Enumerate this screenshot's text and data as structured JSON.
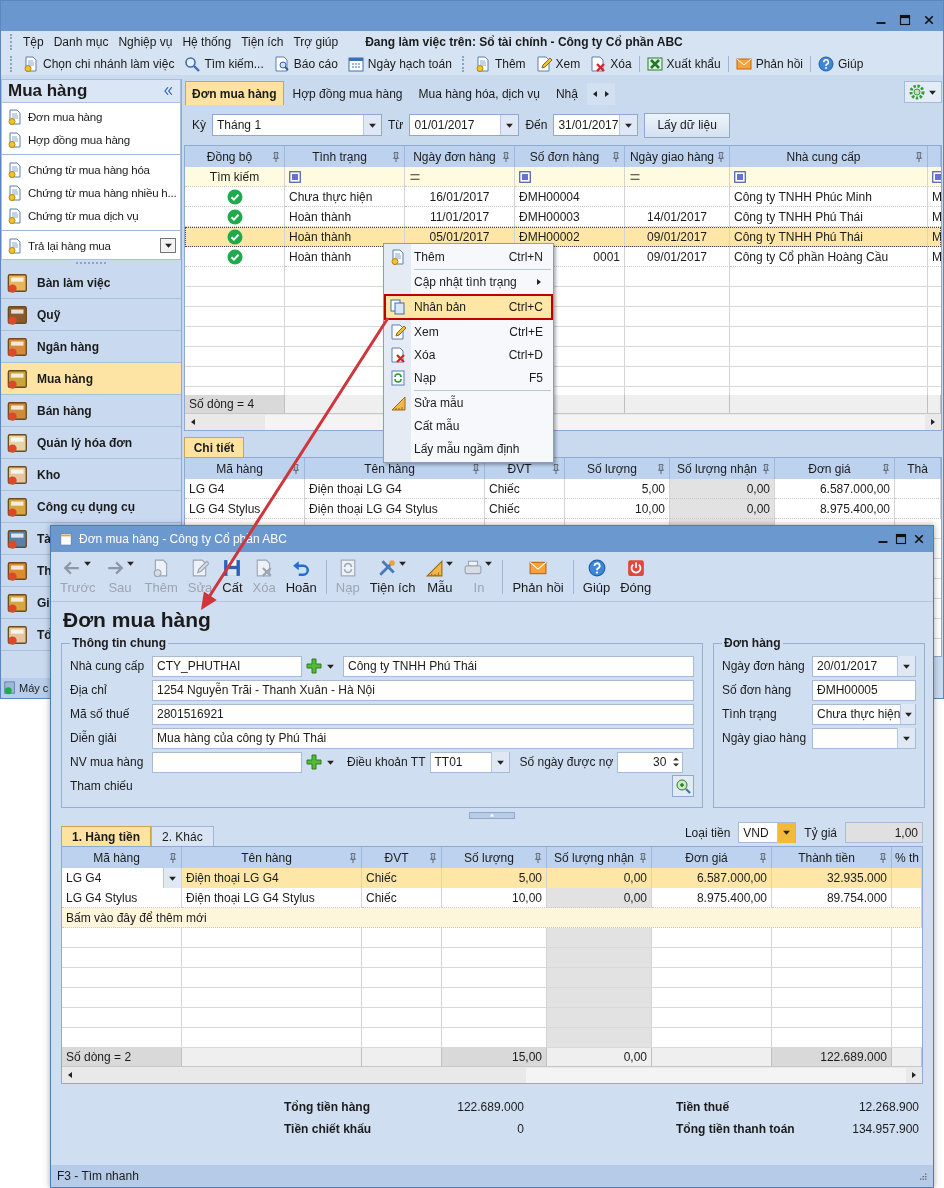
{
  "menu_bar": {
    "items": [
      "Tệp",
      "Danh mục",
      "Nghiệp vụ",
      "Hệ thống",
      "Tiện ích",
      "Trợ giúp"
    ],
    "context": "Đang làm việc trên: Sổ tài chính - Công ty Cổ phần ABC"
  },
  "toolbar": [
    [
      "Chọn chi nhánh làm việc",
      "Tìm kiếm...",
      "Báo cáo",
      "Ngày hạch toán"
    ],
    [
      "Thêm",
      "Xem",
      "Xóa"
    ],
    [
      "Xuất khẩu"
    ],
    [
      "Phản hồi"
    ],
    [
      "Giúp"
    ]
  ],
  "sidebar": {
    "title": "Mua hàng",
    "link_groups": [
      [
        "Đơn mua hàng",
        "Hợp đồng mua hàng"
      ],
      [
        "Chứng từ mua hàng hóa",
        "Chứng từ mua hàng nhiều h...",
        "Chứng từ mua dịch vụ"
      ]
    ],
    "dropdown_link": "Trả lại hàng mua",
    "modules": [
      {
        "label": "Bàn làm việc",
        "selected": false
      },
      {
        "label": "Quỹ",
        "selected": false
      },
      {
        "label": "Ngân hàng",
        "selected": false
      },
      {
        "label": "Mua hàng",
        "selected": true
      },
      {
        "label": "Bán hàng",
        "selected": false
      },
      {
        "label": "Quản lý hóa đơn",
        "selected": false
      },
      {
        "label": "Kho",
        "selected": false
      },
      {
        "label": "Công cụ dụng cụ",
        "selected": false
      },
      {
        "label": "Tà",
        "selected": false
      },
      {
        "label": "Th",
        "selected": false
      },
      {
        "label": "Gi",
        "selected": false
      },
      {
        "label": "Tổ",
        "selected": false
      }
    ],
    "status": "Máy c"
  },
  "tabs": [
    {
      "label": "Đơn mua hàng",
      "selected": true
    },
    {
      "label": "Hợp đồng mua hàng",
      "selected": false
    },
    {
      "label": "Mua hàng hóa, dịch vụ",
      "selected": false
    },
    {
      "label": "Nhậ",
      "selected": false
    }
  ],
  "filter": {
    "period_label": "Kỳ",
    "period": "Tháng 1",
    "from_label": "Từ",
    "from": "01/01/2017",
    "to_label": "Đến",
    "to": "31/01/2017",
    "button": "Lấy dữ liệu"
  },
  "orders": {
    "columns": [
      "Đồng bộ",
      "Tình trạng",
      "Ngày đơn hàng",
      "Số đơn hàng",
      "Ngày giao hàng",
      "Nhà cung cấp"
    ],
    "search_label": "Tìm kiếm",
    "rows": [
      {
        "synced": true,
        "status": "Chưa thực hiện",
        "order_date": "16/01/2017",
        "number": "ĐMH00004",
        "supplier": "Công ty TNHH Phúc Minh",
        "column_7": "M",
        "selected": false
      },
      {
        "synced": true,
        "status": "Hoàn thành",
        "order_date": "11/01/2017",
        "number": "ĐMH00003",
        "delivery_date": "14/01/2017",
        "supplier": "Công ty TNHH Phú Thái",
        "column_7": "M",
        "selected": false
      },
      {
        "synced": true,
        "status": "Hoàn thành",
        "order_date": "05/01/2017",
        "number": "ĐMH00002",
        "delivery_date": "09/01/2017",
        "supplier": "Công ty TNHH Phú Thái",
        "column_7": "M",
        "selected": true
      },
      {
        "synced": true,
        "status": "Hoàn thành",
        "number": "0001",
        "delivery_date": "09/01/2017",
        "supplier": "Công ty Cổ phần Hoàng Cầu",
        "column_7": "M",
        "selected": false
      }
    ],
    "footer": "Số dòng = 4"
  },
  "detail": {
    "tab": "Chi tiết",
    "columns": [
      "Mã hàng",
      "Tên hàng",
      "ĐVT",
      "Số lượng",
      "Số lượng nhận",
      "Đơn giá",
      "Thà"
    ],
    "rows": [
      {
        "code": "LG G4",
        "name": "Điện thoại LG G4",
        "unit": "Chiếc",
        "quantity": "5,00",
        "received": "0,00",
        "price": "6.587.000,00"
      },
      {
        "code": "LG G4 Stylus",
        "name": "Điện thoại LG G4 Stylus",
        "unit": "Chiếc",
        "quantity": "10,00",
        "received": "0,00",
        "price": "8.975.400,00"
      }
    ]
  },
  "context_menu": {
    "groups": [
      [
        {
          "label": "Thêm",
          "shortcut": "Ctrl+N",
          "kind": "item",
          "selected": false
        }
      ],
      [
        {
          "label": "Cập nhật tình trạng",
          "kind": "submenu",
          "selected": false
        }
      ],
      [
        {
          "label": "Nhân bản",
          "shortcut": "Ctrl+C",
          "kind": "item",
          "selected": true
        }
      ],
      [
        {
          "label": "Xem",
          "shortcut": "Ctrl+E",
          "kind": "item",
          "selected": false
        },
        {
          "label": "Xóa",
          "shortcut": "Ctrl+D",
          "kind": "item",
          "selected": false
        },
        {
          "label": "Nạp",
          "shortcut": "F5",
          "kind": "item",
          "selected": false
        }
      ],
      [
        {
          "label": "Sửa mẫu",
          "kind": "item",
          "selected": false
        },
        {
          "label": "Cất mẫu",
          "kind": "item",
          "selected": false
        },
        {
          "label": "Lấy mẫu ngầm định",
          "kind": "item",
          "selected": false
        }
      ]
    ]
  },
  "dialog": {
    "title": "Đơn mua hàng - Công ty Cổ phần ABC",
    "toolbar": [
      [
        {
          "label": "Trước",
          "disabled": true,
          "dropdown": true
        },
        {
          "label": "Sau",
          "disabled": true,
          "dropdown": true
        },
        {
          "label": "Thêm",
          "disabled": true,
          "dropdown": false
        },
        {
          "label": "Sửa",
          "disabled": true,
          "dropdown": false
        },
        {
          "label": "Cất",
          "disabled": false,
          "dropdown": false
        },
        {
          "label": "Xóa",
          "disabled": true,
          "dropdown": false
        },
        {
          "label": "Hoãn",
          "disabled": false,
          "dropdown": false
        }
      ],
      [
        {
          "label": "Nạp",
          "disabled": true,
          "dropdown": false
        },
        {
          "label": "Tiện ích",
          "disabled": false,
          "dropdown": true
        },
        {
          "label": "Mẫu",
          "disabled": false,
          "dropdown": true
        },
        {
          "label": "In",
          "disabled": true,
          "dropdown": true
        }
      ],
      [
        {
          "label": "Phản hồi",
          "disabled": false,
          "dropdown": false
        }
      ],
      [
        {
          "label": "Giúp",
          "disabled": false,
          "dropdown": false
        },
        {
          "label": "Đóng",
          "disabled": false,
          "dropdown": false
        }
      ]
    ],
    "heading": "Đơn mua hàng",
    "general": {
      "title": "Thông tin chung",
      "supplier_label": "Nhà cung cấp",
      "supplier_code": "CTY_PHUTHAI",
      "supplier_name": "Công ty TNHH Phú Thái",
      "address_label": "Địa chỉ",
      "address": "1254 Nguyễn Trãi - Thanh Xuân - Hà Nội",
      "tax_label": "Mã số thuế",
      "tax_code": "2801516921",
      "description_label": "Diễn giải",
      "description": "Mua hàng của công ty Phú Thái",
      "staff_label": "NV mua hàng",
      "terms_label": "Điều khoản TT",
      "terms": "TT01",
      "credit_days_label": "Số ngày được nợ",
      "credit_days": "30",
      "reference_label": "Tham chiếu"
    },
    "order": {
      "title": "Đơn hàng",
      "fields": [
        {
          "label": "Ngày đơn hàng",
          "value": "20/01/2017",
          "kind": "dropdown"
        },
        {
          "label": "Số đơn hàng",
          "value": "ĐMH00005",
          "kind": "text"
        },
        {
          "label": "Tình trạng",
          "value": "Chưa thực hiện",
          "kind": "dropdown"
        },
        {
          "label": "Ngày giao hàng",
          "kind": "dropdown"
        }
      ]
    },
    "tabs": [
      {
        "label": "1. Hàng tiền",
        "selected": true
      },
      {
        "label": "2. Khác",
        "selected": false
      }
    ],
    "currency_label": "Loại tiền",
    "currency": "VND",
    "rate_label": "Tỷ giá",
    "rate": "1,00",
    "columns": [
      "Mã hàng",
      "Tên hàng",
      "ĐVT",
      "Số lượng",
      "Số lượng nhận",
      "Đơn giá",
      "Thành tiền",
      "% th"
    ],
    "rows": [
      {
        "cells": [
          "LG G4",
          "Điện thoại LG G4",
          "Chiếc",
          "5,00",
          "0,00",
          "6.587.000,00",
          "32.935.000"
        ],
        "selected": true
      },
      {
        "cells": [
          "LG G4 Stylus",
          "Điện thoại LG G4 Stylus",
          "Chiếc",
          "10,00",
          "0,00",
          "8.975.400,00",
          "89.754.000"
        ],
        "selected": false
      }
    ],
    "add_row": "Bấm vào đây để thêm mới",
    "footer": {
      "label": "Số dòng = 2",
      "quantity": "15,00",
      "received": "0,00",
      "amount": "122.689.000"
    },
    "totals": {
      "left": [
        {
          "label": "Tổng tiền hàng",
          "value": "122.689.000"
        },
        {
          "label": "Tiền chiết khấu",
          "value": "0"
        }
      ],
      "right": [
        {
          "label": "Tiền thuế",
          "value": "12.268.900"
        },
        {
          "label": "Tổng tiền thanh toán",
          "value": "134.957.900"
        }
      ]
    },
    "status": "F3 - Tìm nhanh"
  }
}
